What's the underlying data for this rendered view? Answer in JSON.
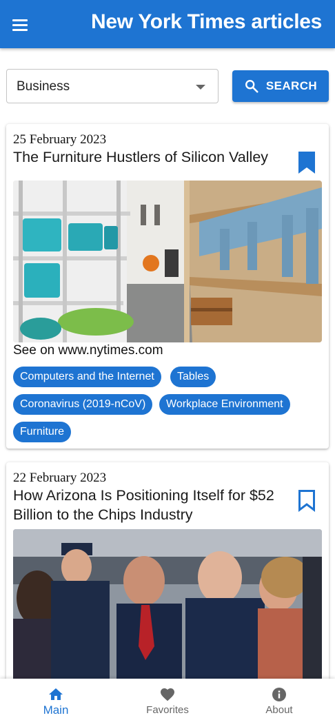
{
  "appbar": {
    "title": "New York Times articles",
    "menu_icon": "menu-icon"
  },
  "filter": {
    "section_value": "Business",
    "search_label": "SEARCH",
    "search_icon": "search-icon"
  },
  "articles": [
    {
      "date": "25 February 2023",
      "title": "The Furniture Hustlers of Silicon Valley",
      "bookmarked": true,
      "source": "See on www.nytimes.com",
      "tags": [
        "Computers and the Internet",
        "Tables",
        "Coronavirus (2019-nCoV)",
        "Workplace Environment",
        "Furniture"
      ]
    },
    {
      "date": "22 February 2023",
      "title": "How Arizona Is Positioning Itself for $52 Billion to the Chips Industry",
      "bookmarked": false
    }
  ],
  "bottom_nav": {
    "items": [
      {
        "label": "Main",
        "icon": "home-icon",
        "active": true
      },
      {
        "label": "Favorites",
        "icon": "heart-icon",
        "active": false
      },
      {
        "label": "About",
        "icon": "info-icon",
        "active": false
      }
    ]
  },
  "colors": {
    "primary": "#1e74d2",
    "inactive": "#666666"
  }
}
